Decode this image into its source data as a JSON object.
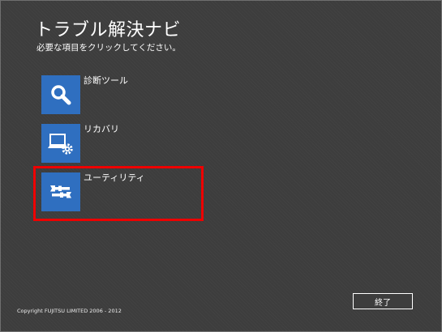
{
  "header": {
    "title": "トラブル解決ナビ",
    "subtitle": "必要な項目をクリックしてください。"
  },
  "menu": {
    "items": [
      {
        "label": "診断ツール",
        "icon": "magnifier-icon",
        "selected": false
      },
      {
        "label": "リカバリ",
        "icon": "laptop-gear-icon",
        "selected": false
      },
      {
        "label": "ユーティリティ",
        "icon": "tools-icon",
        "selected": true
      }
    ]
  },
  "footer": {
    "copyright": "Copyright FUJITSU LIMITED 2006 - 2012",
    "exit_label": "終了"
  },
  "colors": {
    "background": "#3d3d3d",
    "tile": "#2f6fc0",
    "highlight": "#ee0000",
    "text": "#ffffff"
  }
}
